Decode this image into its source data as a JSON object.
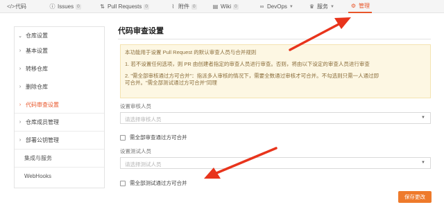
{
  "tabs": [
    {
      "icon": "code-icon",
      "glyph": "</>",
      "label": "代码"
    },
    {
      "icon": "issues-icon",
      "glyph": "ⓘ",
      "label": "Issues",
      "count": "0"
    },
    {
      "icon": "pull-request-icon",
      "glyph": "⇅",
      "label": "Pull Requests",
      "count": "0"
    },
    {
      "icon": "attachment-icon",
      "glyph": "⌇",
      "label": "附件",
      "count": "0"
    },
    {
      "icon": "wiki-icon",
      "glyph": "▤",
      "label": "Wiki",
      "count": "0"
    },
    {
      "icon": "devops-icon",
      "glyph": "∞",
      "label": "DevOps"
    },
    {
      "icon": "service-icon",
      "glyph": "♛",
      "label": "服务"
    },
    {
      "icon": "manage-icon",
      "glyph": "⚙",
      "label": "管理"
    }
  ],
  "sidebar": {
    "items": [
      {
        "label": "仓库设置"
      },
      {
        "label": "基本设置"
      },
      {
        "label": "转移仓库"
      },
      {
        "label": "删除仓库"
      },
      {
        "label": "代码审查设置"
      },
      {
        "label": "仓库成员管理"
      },
      {
        "label": "部署公钥管理"
      },
      {
        "label": "集成与服务"
      },
      {
        "label": "WebHooks"
      }
    ]
  },
  "main": {
    "title": "代码审查设置",
    "notice": {
      "line1": "本功能用于设置 Pull Request 的默认审查人员与合并规则",
      "line2": "1. 若不设置任何选项，则 PR 由创建者指定的审查人员进行审查。否则，将由以下设定的审查人员进行审查",
      "line3": "2. \"需全部审核通过方可合并\"：指派多人审核的情况下，需要全数通过审核才可合并。不勾选则只需一人通过即",
      "line4": "可合并。\"需全部测试通过方可合并\"同理"
    },
    "reviewer_label": "设置审核人员",
    "reviewer_placeholder": "请选择审核人员",
    "reviewer_checkbox": "需全部审查通过方可合并",
    "tester_label": "设置测试人员",
    "tester_placeholder": "请选择测试人员",
    "tester_checkbox": "需全部测试通过方可合并",
    "save_label": "保存更改"
  },
  "colors": {
    "accent": "#e8562a",
    "button": "#ee7a2b",
    "notice_bg": "#fdf7e3",
    "annotation_arrow": "#e8341c"
  }
}
